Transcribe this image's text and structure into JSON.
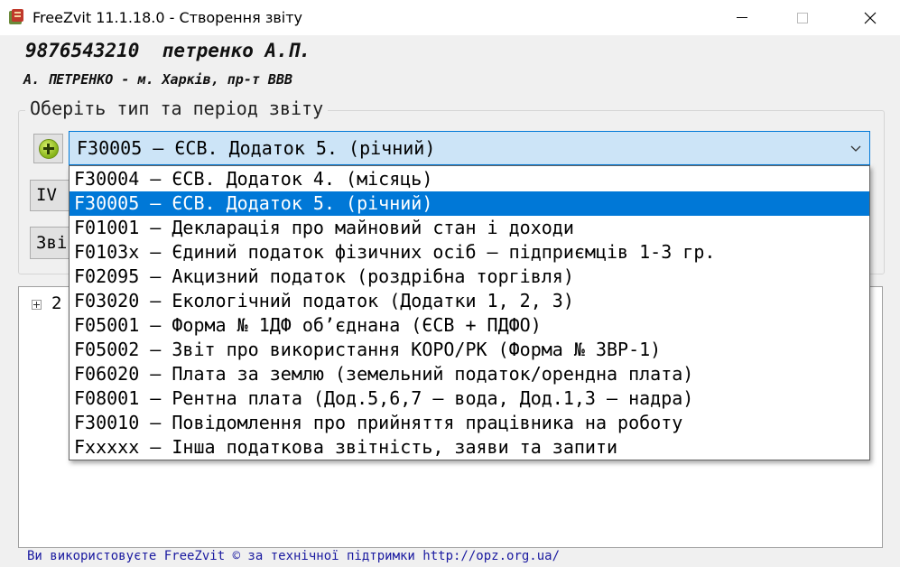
{
  "window": {
    "title": "FreeZvit 11.1.18.0 - Створення звіту",
    "icon": "freezvit-app-icon"
  },
  "user": {
    "line1": "9876543210  петренко А.П.",
    "line2": "А. ПЕТРЕНКО - м. Харків, пр-т ВВВ"
  },
  "report_group": {
    "legend": "Оберіть тип та період звіту",
    "add_button_icon": "add-plus-icon",
    "selected_value": "F30005 – ЄСВ. Додаток 5. (річний)",
    "dropdown_items": [
      {
        "label": "F30004 – ЄСВ. Додаток 4. (місяць)",
        "selected": false
      },
      {
        "label": "F30005 – ЄСВ. Додаток 5. (річний)",
        "selected": true
      },
      {
        "label": "F01001 – Декларація про майновий стан і доходи",
        "selected": false
      },
      {
        "label": "F0103x – Єдиний податок фізичних осіб – підприємців 1-3 гр.",
        "selected": false
      },
      {
        "label": "F02095 – Акцизний податок (роздрібна торгівля)",
        "selected": false
      },
      {
        "label": "F03020 – Екологічний податок (Додатки 1, 2, 3)",
        "selected": false
      },
      {
        "label": "F05001 – Форма № 1ДФ об’єднана (ЄСВ + ПДФО)",
        "selected": false
      },
      {
        "label": "F05002 – Звіт про використання КОРО/РК (Форма № ЗВР-1)",
        "selected": false
      },
      {
        "label": "F06020 – Плата за землю (земельний податок/орендна плата)",
        "selected": false
      },
      {
        "label": "F08001 – Рентна плата (Дод.5,6,7 – вода, Дод.1,3 – надра)",
        "selected": false
      },
      {
        "label": "F30010 – Повідомлення про прийняття працівника на роботу",
        "selected": false
      },
      {
        "label": "Fxxxxx – Інша податкова звітність, заяви та запити",
        "selected": false
      }
    ],
    "period_button_label": "IV",
    "create_button_label": "Зві"
  },
  "tree": {
    "first_node_label": "2"
  },
  "footer": {
    "text": "Ви використовуєте FreeZvit © за технічної підтримки http://opz.org.ua/"
  },
  "colors": {
    "selection": "#0078d7",
    "combo_bg": "#cce4f7",
    "footer_text": "#1a1aa0"
  }
}
